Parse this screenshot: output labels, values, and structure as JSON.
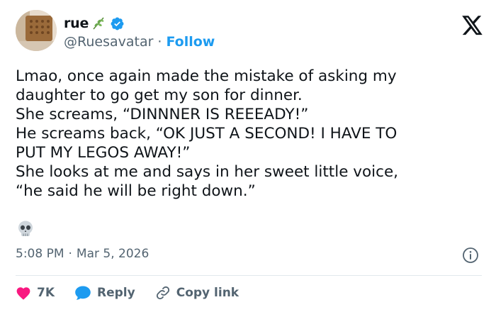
{
  "user": {
    "display_name": "rue",
    "handle": "@Ruesavatar",
    "separator": "·",
    "follow_label": "Follow",
    "name_emoji": "plant-emoji",
    "verified_color": "#1d9bf0"
  },
  "tweet": {
    "lines": [
      "Lmao, once again made the mistake of asking my",
      "daughter to go get my son for dinner.",
      "She screams, “DINNNER IS REEEADY!”",
      "He screams back, “OK JUST A SECOND! I HAVE TO",
      "PUT MY LEGOS AWAY!”",
      "She looks at me and says in her sweet little voice,",
      "“he said he will be right down.”"
    ],
    "emoji": "skull-emoji"
  },
  "meta": {
    "time": "5:08 PM",
    "separator": "·",
    "date": "Mar 5, 2026"
  },
  "actions": {
    "like_count": "7K",
    "reply_label": "Reply",
    "copy_link_label": "Copy link"
  },
  "colors": {
    "accent": "#1d9bf0",
    "like": "#f91880",
    "muted": "#536471",
    "text": "#0f1419"
  }
}
